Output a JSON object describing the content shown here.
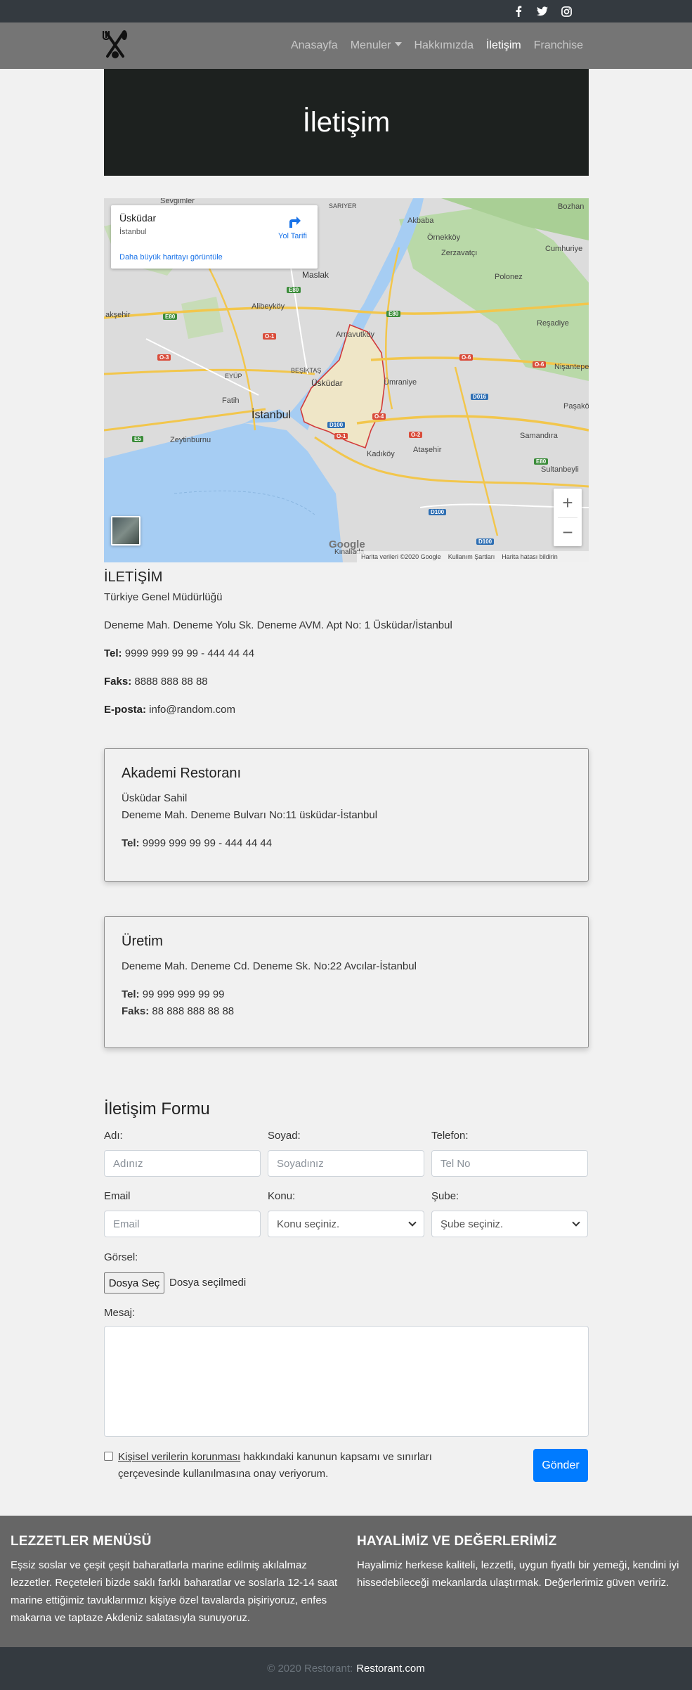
{
  "topbar": {
    "social": [
      {
        "icon": "facebook-icon",
        "glyph": "f"
      },
      {
        "icon": "twitter-icon",
        "glyph": "🐦"
      },
      {
        "icon": "instagram-icon",
        "glyph": "◎"
      }
    ]
  },
  "navbar": {
    "items": [
      {
        "label": "Anasayfa",
        "active": false
      },
      {
        "label": "Menuler",
        "active": false,
        "dropdown": true
      },
      {
        "label": "Hakkımızda",
        "active": false
      },
      {
        "label": "İletişim",
        "active": true
      },
      {
        "label": "Franchise",
        "active": false
      }
    ]
  },
  "hero": {
    "title": "İletişim"
  },
  "map": {
    "card": {
      "place": "Üsküdar",
      "city": "İstanbul",
      "directions": "Yol Tarifi",
      "bigger_map": "Daha büyük haritayı görüntüle"
    },
    "labels": {
      "istanbul": "İstanbul",
      "uskudar": "Üsküdar",
      "sariyer": "SARIYER",
      "akbaba": "Akbaba",
      "ornekkoy": "Örnekköy",
      "cumhuriye": "Cumhuriye",
      "zerzavatci": "Zerzavatçı",
      "polonez": "Polonez",
      "maslak": "Maslak",
      "alibeykoy": "Alibeyköy",
      "reşadiye": "Reşadiye",
      "nisantepe": "Nişantepe",
      "arnavutkoy": "Arnavutköy",
      "besiktas": "BEŞİKTAŞ",
      "umraniye": "Ümraniye",
      "fatih": "Fatih",
      "eyup": "EYÜP",
      "pasakoy": "Paşakö",
      "samandira": "Samandıra",
      "atasehir": "Ataşehir",
      "sultanbeyli": "Sultanbeyli",
      "kadikoy": "Kadıköy",
      "zeytinburnu": "Zeytinburnu",
      "kinaliada": "Kınalıada",
      "aksehir": "akşehir",
      "bozhan": "Bozhan",
      "seyrantepe": "Sevgimler"
    },
    "attribution": {
      "data": "Harita verileri ©2020 Google",
      "terms": "Kullanım Şartları",
      "report": "Harita hatası bildirin"
    },
    "logo": "Google",
    "zoom_in": "+",
    "zoom_out": "−"
  },
  "contact": {
    "heading": "İLETİŞİM",
    "office": "Türkiye Genel Müdürlüğü",
    "address": "Deneme Mah. Deneme Yolu Sk. Deneme AVM. Apt No: 1 Üsküdar/İstanbul",
    "tel_label": "Tel:",
    "tel": "9999 999 99 99 - 444 44 44",
    "fax_label": "Faks:",
    "fax": "8888 888 88 88",
    "email_label": "E-posta:",
    "email": "info@random.com"
  },
  "branches": [
    {
      "title": "Akademi Restoranı",
      "line1": "Üsküdar Sahil",
      "line2": "Deneme Mah. Deneme Bulvarı No:11 üsküdar-İstanbul",
      "tel_label": "Tel:",
      "tel": "9999 999 99 99 - 444 44 44"
    },
    {
      "title": "Üretim",
      "line1": "Deneme Mah. Deneme Cd. Deneme Sk. No:22 Avcılar-İstanbul",
      "tel_label": "Tel:",
      "tel": "99 999 999 99 99",
      "fax_label": "Faks:",
      "fax": "88 888 888 88 88"
    }
  ],
  "form": {
    "title": "İletişim Formu",
    "name_label": "Adı:",
    "name_placeholder": "Adınız",
    "surname_label": "Soyad:",
    "surname_placeholder": "Soyadınız",
    "phone_label": "Telefon:",
    "phone_placeholder": "Tel No",
    "email_label": "Email",
    "email_placeholder": "Email",
    "subject_label": "Konu:",
    "subject_value": "Konu seçiniz.",
    "branch_label": "Şube:",
    "branch_value": "Şube seçiniz.",
    "image_label": "Görsel:",
    "file_button": "Dosya Seç",
    "file_status": "Dosya seçilmedi",
    "message_label": "Mesaj:",
    "consent_link": "Kişisel verilerin korunması",
    "consent_text": " hakkındaki kanunun kapsamı ve sınırları çerçevesinde kullanılmasına onay veriyorum.",
    "submit": "Gönder"
  },
  "footer": {
    "col1_title": "LEZZETLER MENÜSÜ",
    "col1_text": "Eşsiz soslar ve çeşit çeşit baharatlarla marine edilmiş akılalmaz lezzetler. Reçeteleri bizde saklı farklı baharatlar ve soslarla 12-14 saat marine ettiğimiz tavuklarımızı kişiye özel tavalarda pişiriyoruz, enfes makarna ve taptaze Akdeniz salatasıyla sunuyoruz.",
    "col2_title": "HAYALİMİZ VE DEĞERLERİMİZ",
    "col2_text": "Hayalimiz herkese kaliteli, lezzetli, uygun fiyatlı bir yemeği, kendini iyi hissedebileceği mekanlarda ulaştırmak. Değerlerimiz güven veririz.",
    "copyright": "© 2020 Restorant:",
    "site": "Restorant.com"
  }
}
